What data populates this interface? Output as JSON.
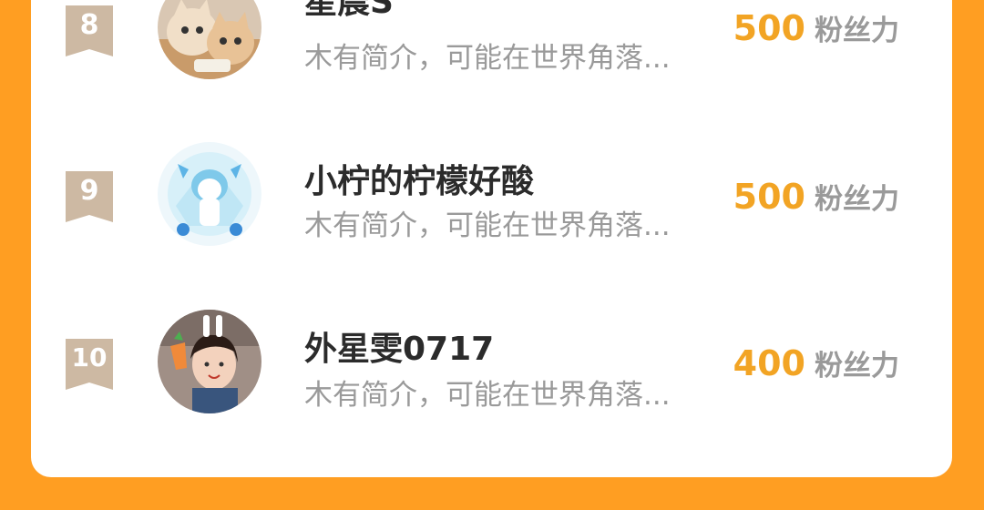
{
  "list": [
    {
      "rank": "8",
      "name": "星晨S",
      "bio": "木有简介，可能在世界角落...",
      "fans_value": "500",
      "fans_unit": "粉丝力",
      "avatar": "cats-photo"
    },
    {
      "rank": "9",
      "name": "小柠的柠檬好酸",
      "bio": "木有简介，可能在世界角落...",
      "fans_value": "500",
      "fans_unit": "粉丝力",
      "avatar": "anime-girl-illustration"
    },
    {
      "rank": "10",
      "name": "外星雯0717",
      "bio": "木有简介，可能在世界角落...",
      "fans_value": "400",
      "fans_unit": "粉丝力",
      "avatar": "child-with-bunny-ears-photo"
    }
  ],
  "colors": {
    "background": "#FF9E22",
    "card": "#FFFFFF",
    "accent_value": "#F2A424",
    "rank_badge": "#CDB9A3"
  }
}
